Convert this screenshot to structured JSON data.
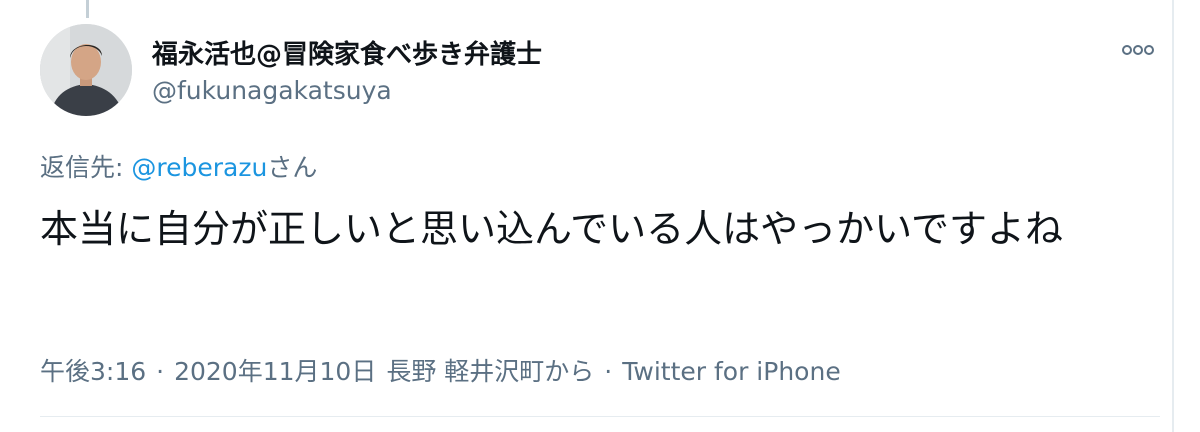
{
  "tweet": {
    "author": {
      "display_name": "福永活也@冒険家食べ歩き弁護士",
      "handle": "@fukunagakatsuya"
    },
    "more_icon": "more-horizontal-icon",
    "reply": {
      "prefix": "返信先: ",
      "mention": "@reberazu",
      "suffix": "さん"
    },
    "text": "本当に自分が正しいと思い込んでいる人はやっかいですよね",
    "meta": {
      "time": "午後3:16",
      "separator": "·",
      "date": "2020年11月10日",
      "location": "長野 軽井沢町から",
      "source": "Twitter for iPhone"
    }
  },
  "colors": {
    "text": "#0f1419",
    "secondary": "#5b7083",
    "link": "#1b95e0",
    "divider": "#e6ecf0"
  }
}
